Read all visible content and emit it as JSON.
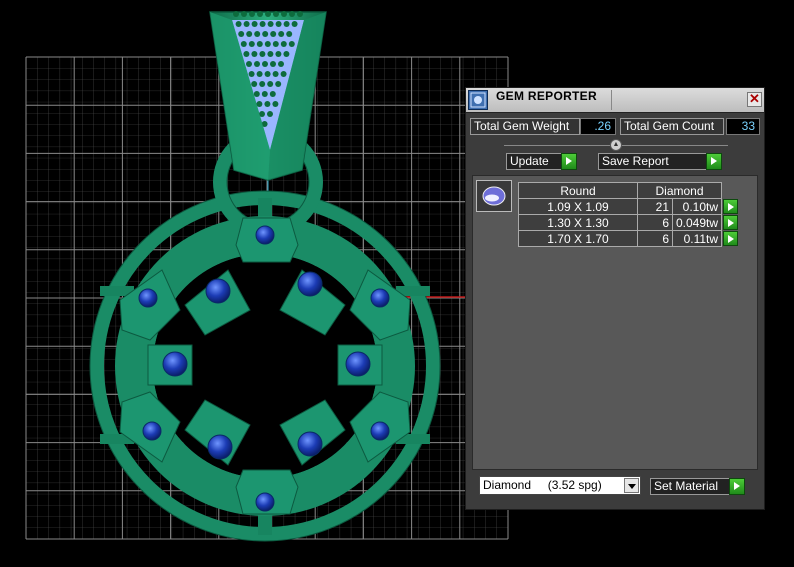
{
  "panel": {
    "title": "GEM REPORTER",
    "close_glyph": "✕",
    "total_weight_label": "Total Gem Weight",
    "total_weight_value": ".26",
    "total_count_label": "Total Gem Count",
    "total_count_value": "33",
    "update_label": "Update",
    "save_report_label": "Save Report",
    "table": {
      "headers": [
        "Round",
        "Diamond"
      ],
      "rows": [
        {
          "size": "1.09 X 1.09",
          "count": "21",
          "weight": "0.10tw"
        },
        {
          "size": "1.30 X 1.30",
          "count": "6",
          "weight": "0.049tw"
        },
        {
          "size": "1.70 X 1.70",
          "count": "6",
          "weight": "0.11tw"
        }
      ]
    },
    "material_select": "Diamond     (3.52 spg)",
    "set_material_label": "Set Material"
  },
  "icons": {
    "app": "gem-reporter-icon",
    "close": "close-icon",
    "thumb": "round-gem-icon",
    "go": "play-arrow-icon",
    "dropdown": "chevron-down-icon"
  },
  "colors": {
    "model_green": "#1a8c66",
    "gem_blue": "#1b3fae",
    "value_text": "#7ad3ff",
    "go_green": "#2fae28"
  }
}
